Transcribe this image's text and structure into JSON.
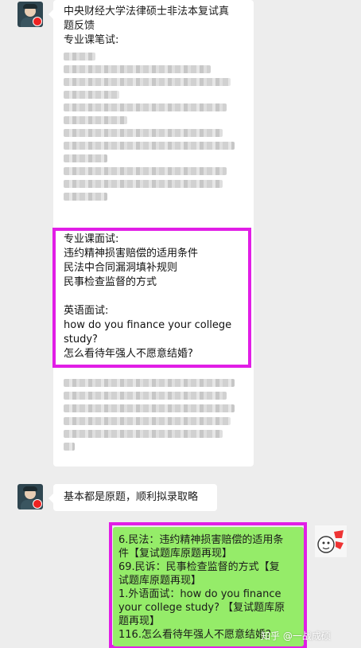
{
  "messages": {
    "first": {
      "title_line1": "中央财经大学法律硕士非法本复试真",
      "title_line2": "题反馈",
      "written_heading": "专业课笔试:",
      "interview_heading": "专业课面试:",
      "interview_items": [
        "违约精神损害赔偿的适用条件",
        "民法中合同漏洞填补规则",
        "民事检查监督的方式"
      ],
      "english_heading": "英语面试:",
      "english_q1_line1": "how do you finance your college",
      "english_q1_line2": "study?",
      "english_q2": "怎么看待年强人不愿意结婚?"
    },
    "second": {
      "text": "基本都是原题，顺利拟录取略"
    },
    "reply": {
      "lines": [
        "6.民法：违约精神损害赔偿的适用条",
        "件【复试题库原题再现】",
        "69.民诉：民事检查监督的方式【复",
        "试题库原题再现】",
        "1.外语面试：how do you finance",
        "your college study? 【复试题库原",
        "题再现】",
        "116.怎么看待年强人不愿意结婚？"
      ]
    }
  },
  "watermark": "知乎 @一战成硕",
  "colors": {
    "highlight": "#e11ee6",
    "sent_bubble": "#95ec69",
    "background": "#ededed"
  },
  "icons": {
    "avatar": "soldier-avatar-icon",
    "sticker": "meme-sticker-icon"
  }
}
